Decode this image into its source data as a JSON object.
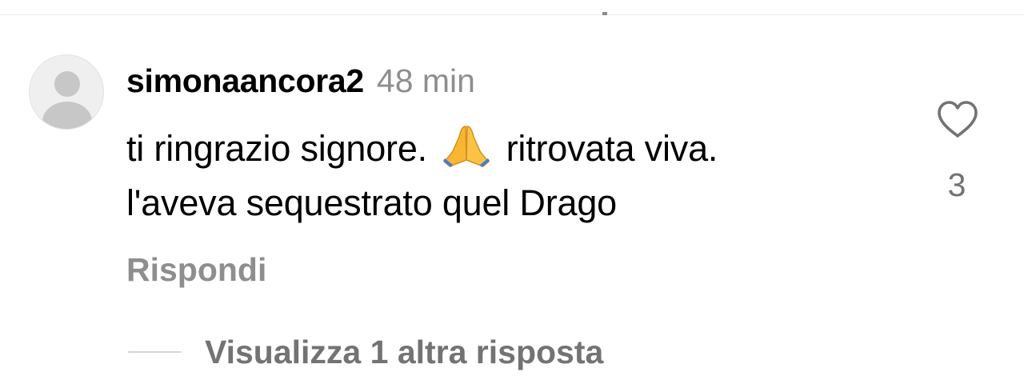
{
  "comment": {
    "username": "simonaancora2",
    "timestamp": "48 min",
    "text_line1_before": "ti ringrazio signore.",
    "emoji": "folded-hands-emoji",
    "text_line1_after": "ritrovata viva.",
    "text_line2": "l'aveva sequestrato quel Drago",
    "reply_label": "Rispondi",
    "like_icon": "heart-outline-icon",
    "like_count": "3",
    "view_replies_label": "Visualizza 1 altra risposta"
  },
  "colors": {
    "text": "#000000",
    "muted": "#8e8e8e",
    "muted_dark": "#737373",
    "emoji": "#f7b733"
  }
}
